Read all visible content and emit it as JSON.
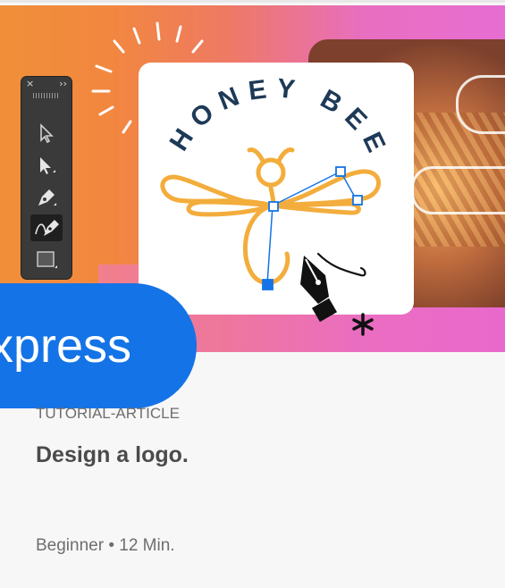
{
  "card": {
    "type_label": "TUTORIAL-ARTICLE",
    "title": "Design a logo.",
    "meta": "Beginner • 12 Min."
  },
  "badge": {
    "label": "xpress",
    "color": "#1473e6"
  },
  "logo": {
    "text": "HONEY BEE",
    "text_color": "#1d3a57",
    "bee_color": "#f3ad3c",
    "anchor_color": "#1473e6"
  },
  "toolbar": {
    "close_glyph": "×",
    "collapse_glyph": "››",
    "tools": [
      "direct-selection-icon",
      "selection-icon",
      "pen-icon",
      "curvature-pen-icon",
      "rectangle-icon"
    ]
  },
  "colors": {
    "hero_left": "#f08f3a",
    "hero_right": "#e76ed2"
  }
}
